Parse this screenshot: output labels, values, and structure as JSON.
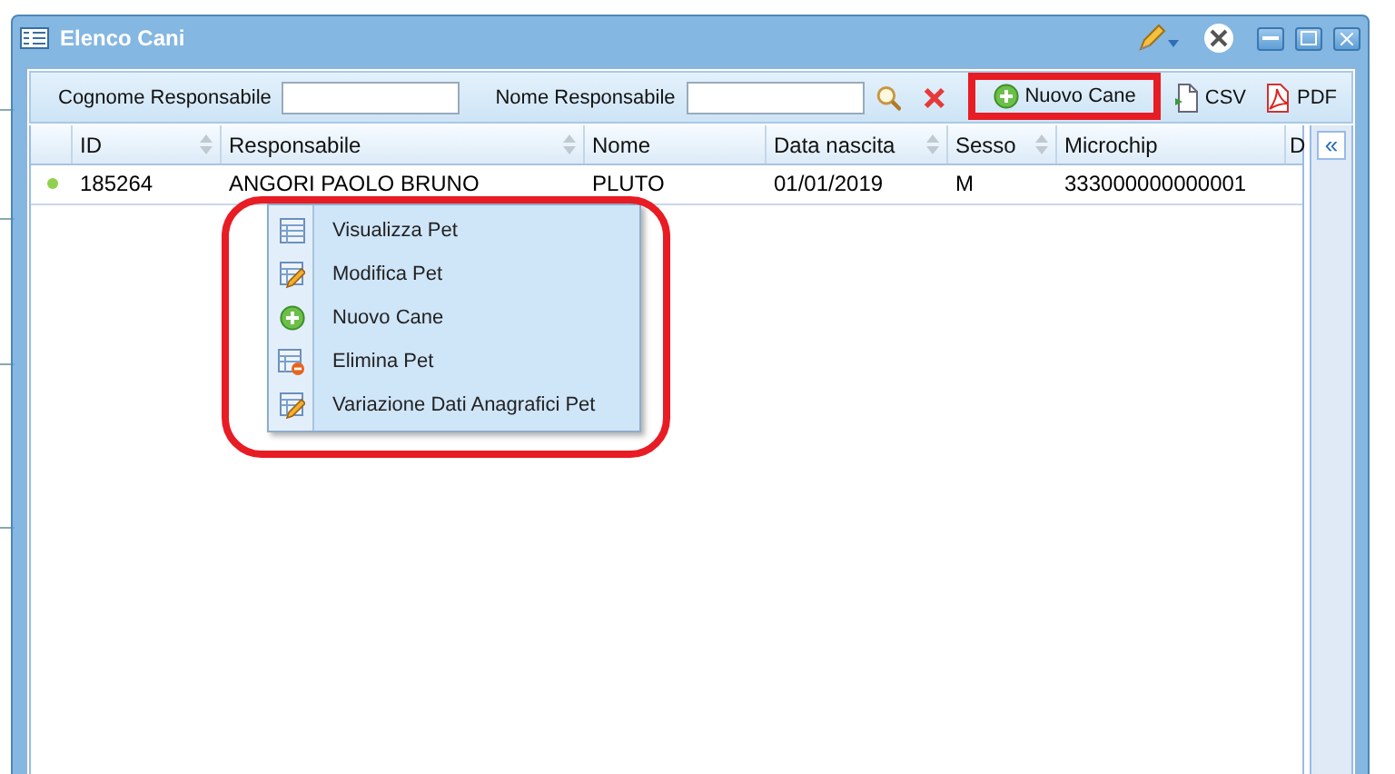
{
  "window": {
    "title": "Elenco Cani"
  },
  "filters": [
    {
      "label": "Cognome Responsabile"
    },
    {
      "label": "Nome Responsabile"
    }
  ],
  "toolbar": {
    "buttons": [
      {
        "kind": "add",
        "label": "Nuovo Cane",
        "highlighted": true
      },
      {
        "kind": "csv",
        "label": "CSV"
      },
      {
        "kind": "pdf",
        "label": "PDF"
      }
    ]
  },
  "table": {
    "columns": [
      {
        "label": "ID",
        "sortable": true
      },
      {
        "label": "Responsabile",
        "sortable": true
      },
      {
        "label": "Nome",
        "sortable": false
      },
      {
        "label": "Data nascita",
        "sortable": true
      },
      {
        "label": "Sesso",
        "sortable": true
      },
      {
        "label": "Microchip",
        "sortable": false
      },
      {
        "label": "D"
      }
    ],
    "rows": [
      {
        "color": "#8fd14f",
        "cells": [
          "185264",
          "ANGORI PAOLO BRUNO",
          "PLUTO",
          "01/01/2019",
          "M",
          "333000000000001"
        ]
      }
    ]
  },
  "side_panel": {
    "toggle": "«"
  },
  "context_menu": {
    "highlighted": true,
    "items": [
      {
        "kind": "view",
        "label": "Visualizza Pet"
      },
      {
        "kind": "edit",
        "label": "Modifica Pet"
      },
      {
        "kind": "add",
        "label": "Nuovo Cane"
      },
      {
        "kind": "delete",
        "label": "Elimina Pet"
      },
      {
        "kind": "edit",
        "label": "Variazione Dati Anagrafici Pet"
      }
    ]
  }
}
